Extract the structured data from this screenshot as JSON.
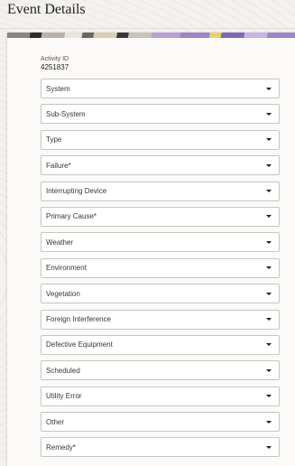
{
  "page": {
    "title": "Event Details"
  },
  "activity": {
    "label": "Activity ID",
    "value": "4251837"
  },
  "fields": [
    {
      "label": "System"
    },
    {
      "label": "Sub-System"
    },
    {
      "label": "Type"
    },
    {
      "label": "Failure*"
    },
    {
      "label": "Interrupting Device"
    },
    {
      "label": "Primary Cause*"
    },
    {
      "label": "Weather"
    },
    {
      "label": "Environment"
    },
    {
      "label": "Vegetation"
    },
    {
      "label": "Foreign Interference"
    },
    {
      "label": "Defective Equipment"
    },
    {
      "label": "Scheduled"
    },
    {
      "label": "Utility Error"
    },
    {
      "label": "Other"
    },
    {
      "label": "Remedy*"
    }
  ],
  "icons": {
    "dropdown": "chevron-down-icon"
  }
}
